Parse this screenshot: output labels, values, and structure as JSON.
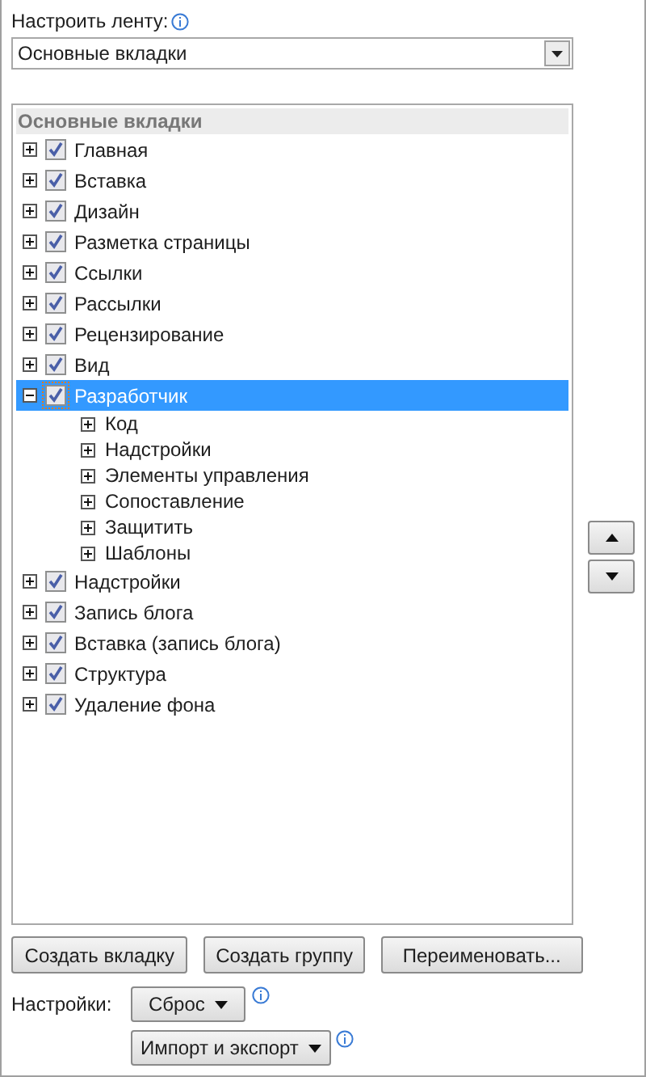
{
  "customize_label": "Настроить ленту:",
  "dropdown": {
    "value": "Основные вкладки"
  },
  "tree": {
    "header": "Основные вкладки",
    "items": [
      {
        "label": "Главная",
        "checked": true,
        "expanded": false,
        "selected": false
      },
      {
        "label": "Вставка",
        "checked": true,
        "expanded": false,
        "selected": false
      },
      {
        "label": "Дизайн",
        "checked": true,
        "expanded": false,
        "selected": false
      },
      {
        "label": "Разметка страницы",
        "checked": true,
        "expanded": false,
        "selected": false
      },
      {
        "label": "Ссылки",
        "checked": true,
        "expanded": false,
        "selected": false
      },
      {
        "label": "Рассылки",
        "checked": true,
        "expanded": false,
        "selected": false
      },
      {
        "label": "Рецензирование",
        "checked": true,
        "expanded": false,
        "selected": false
      },
      {
        "label": "Вид",
        "checked": true,
        "expanded": false,
        "selected": false
      },
      {
        "label": "Разработчик",
        "checked": true,
        "expanded": true,
        "selected": true,
        "children": [
          {
            "label": "Код",
            "expanded": false
          },
          {
            "label": "Надстройки",
            "expanded": false
          },
          {
            "label": "Элементы управления",
            "expanded": false
          },
          {
            "label": "Сопоставление",
            "expanded": false
          },
          {
            "label": "Защитить",
            "expanded": false
          },
          {
            "label": "Шаблоны",
            "expanded": false
          }
        ]
      },
      {
        "label": "Надстройки",
        "checked": true,
        "expanded": false,
        "selected": false
      },
      {
        "label": "Запись блога",
        "checked": true,
        "expanded": false,
        "selected": false
      },
      {
        "label": "Вставка (запись блога)",
        "checked": true,
        "expanded": false,
        "selected": false
      },
      {
        "label": "Структура",
        "checked": true,
        "expanded": false,
        "selected": false
      },
      {
        "label": "Удаление фона",
        "checked": true,
        "expanded": false,
        "selected": false
      }
    ]
  },
  "buttons": [
    "Создать вкладку",
    "Создать группу",
    "Переименовать..."
  ],
  "settings_label": "Настройки:",
  "reset_button": "Сброс",
  "import_export_button": "Импорт и экспорт"
}
